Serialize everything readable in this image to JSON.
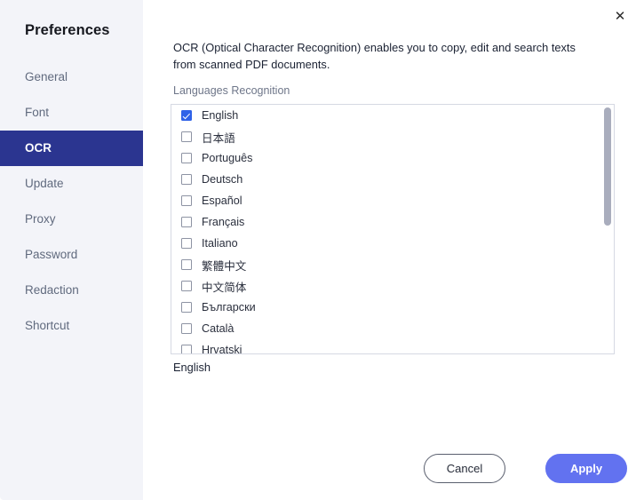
{
  "window": {
    "close_icon": "close-icon",
    "close_glyph": "✕"
  },
  "sidebar": {
    "title": "Preferences",
    "items": [
      {
        "label": "General",
        "active": false
      },
      {
        "label": "Font",
        "active": false
      },
      {
        "label": "OCR",
        "active": true
      },
      {
        "label": "Update",
        "active": false
      },
      {
        "label": "Proxy",
        "active": false
      },
      {
        "label": "Password",
        "active": false
      },
      {
        "label": "Redaction",
        "active": false
      },
      {
        "label": "Shortcut",
        "active": false
      }
    ],
    "active_color": "#2b3590",
    "background_color": "#f3f4f9"
  },
  "main": {
    "description": "OCR (Optical Character Recognition) enables you to copy, edit and search texts from scanned PDF documents.",
    "languages_label": "Languages Recognition",
    "selected_language": "English",
    "languages": [
      {
        "label": "English",
        "checked": true
      },
      {
        "label": "日本語",
        "checked": false
      },
      {
        "label": "Português",
        "checked": false
      },
      {
        "label": "Deutsch",
        "checked": false
      },
      {
        "label": "Español",
        "checked": false
      },
      {
        "label": "Français",
        "checked": false
      },
      {
        "label": "Italiano",
        "checked": false
      },
      {
        "label": "繁體中文",
        "checked": false
      },
      {
        "label": "中文简体",
        "checked": false
      },
      {
        "label": "Български",
        "checked": false
      },
      {
        "label": "Català",
        "checked": false
      },
      {
        "label": "Hrvatski",
        "checked": false
      }
    ],
    "checkbox_checked_color": "#2f62e8"
  },
  "footer": {
    "cancel_label": "Cancel",
    "apply_label": "Apply",
    "apply_color": "#6272f0"
  }
}
